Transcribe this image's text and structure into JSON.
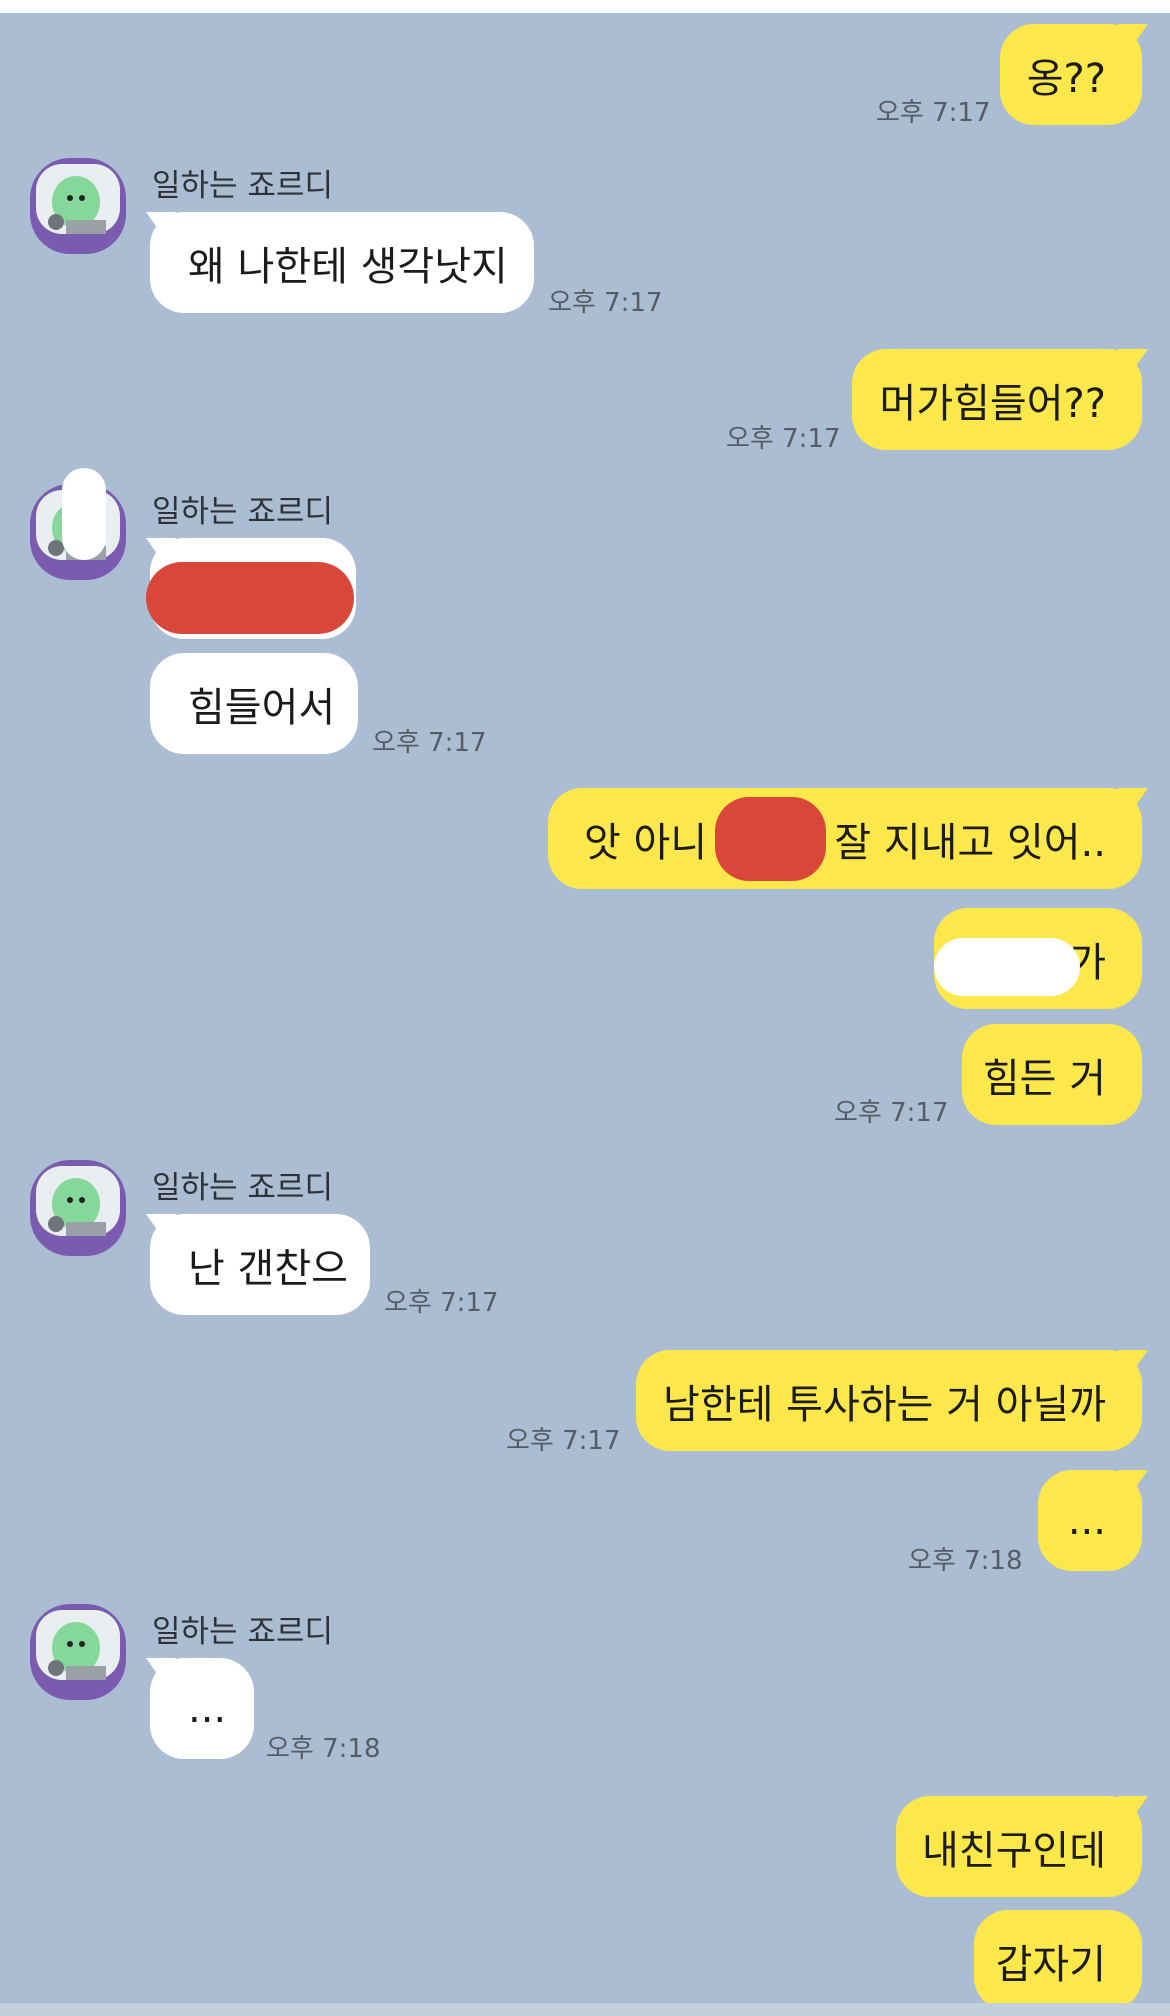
{
  "contact": {
    "name": "일하는 죠르디"
  },
  "icons": {
    "avatar": "jordy-dinosaur-avatar"
  },
  "colors": {
    "background": "#abbdd2",
    "my_bubble": "#fde84b",
    "their_bubble": "#ffffff",
    "avatar_frame": "#7a5bb0",
    "avatar_character": "#85d79a",
    "redaction_red": "#d9473b"
  },
  "messages": [
    {
      "from": "me",
      "text": "옹??",
      "time": "오후 7:17"
    },
    {
      "from": "them",
      "sender": "일하는 죠르디",
      "text": "왜 나한테 생각낫지",
      "time": "오후 7:17"
    },
    {
      "from": "me",
      "text": "머가힘들어??",
      "time": "오후 7:17"
    },
    {
      "from": "them",
      "sender": "일하는 죠르디",
      "text": "",
      "time": ""
    },
    {
      "from": "them",
      "text": "힘들어서",
      "time": "오후 7:17"
    },
    {
      "from": "me",
      "text_before": "앗 아니",
      "text_after": "잘 지내고 잇어..",
      "time": ""
    },
    {
      "from": "me",
      "text": "가",
      "time": ""
    },
    {
      "from": "me",
      "text": "힘든 거",
      "time": "오후 7:17"
    },
    {
      "from": "them",
      "sender": "일하는 죠르디",
      "text": "난 갠찬으",
      "time": "오후 7:17"
    },
    {
      "from": "me",
      "text": "남한테 투사하는 거 아닐까",
      "time": "오후 7:17"
    },
    {
      "from": "me",
      "text": "...",
      "time": "오후 7:18"
    },
    {
      "from": "them",
      "sender": "일하는 죠르디",
      "text": "...",
      "time": "오후 7:18"
    },
    {
      "from": "me",
      "text": "내친구인데",
      "time": ""
    },
    {
      "from": "me",
      "text": "갑자기",
      "time": ""
    }
  ]
}
